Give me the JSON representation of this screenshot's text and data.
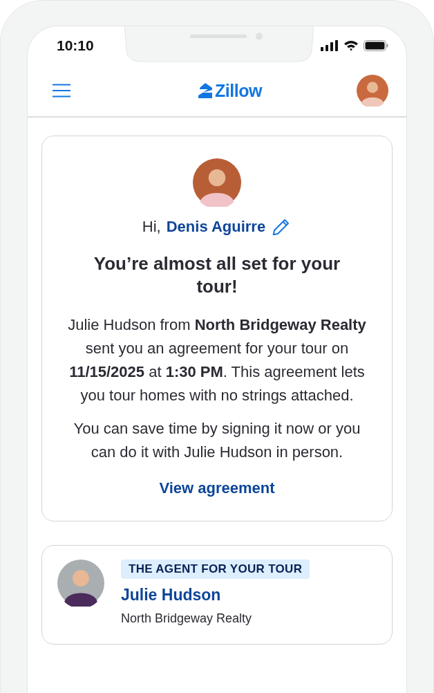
{
  "status_bar": {
    "time": "10:10"
  },
  "header": {
    "logo": "Zillow"
  },
  "tour_card": {
    "greeting": "Hi, ",
    "user_name": "Denis Aguirre",
    "heading": "You’re almost all set for your tour!",
    "paragraphs": [
      "Julie Hudson from **North Bridgeway Realty** sent you an agreement for your tour on **11/15/2025** at **1:30 PM**. This agreement lets you tour homes with no strings attached.",
      "You can save time by signing it now or you can do it with Julie Hudson in person."
    ],
    "link": "View agreement"
  },
  "agent_card": {
    "badge": "THE AGENT FOR YOUR TOUR",
    "name": "Julie Hudson",
    "company": "North Bridgeway Realty"
  }
}
